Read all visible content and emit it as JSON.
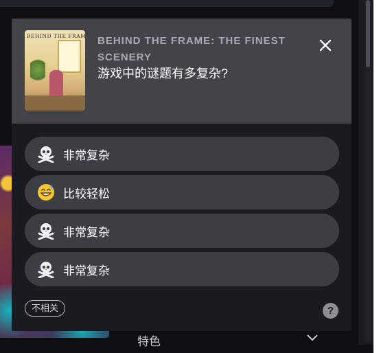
{
  "background": {
    "feature_label": "特色"
  },
  "survey": {
    "game_title": "BEHIND THE FRAME: THE FINEST SCENERY",
    "thumbnail_title": "BEHIND THE FRAME",
    "question": "游戏中的谜题有多复杂?",
    "answers": [
      {
        "label": "非常复杂",
        "icon": "skull-crossbones-icon"
      },
      {
        "label": "比较轻松",
        "icon": "sweat-smile-emoji-icon"
      },
      {
        "label": "非常复杂",
        "icon": "skull-crossbones-icon"
      },
      {
        "label": "非常复杂",
        "icon": "skull-crossbones-icon"
      }
    ],
    "irrelevant_label": "不相关",
    "help_label": "?"
  },
  "colors": {
    "card_header": "#434449",
    "card_body": "#1a1b20",
    "answer_pill": "#3d3e44"
  }
}
